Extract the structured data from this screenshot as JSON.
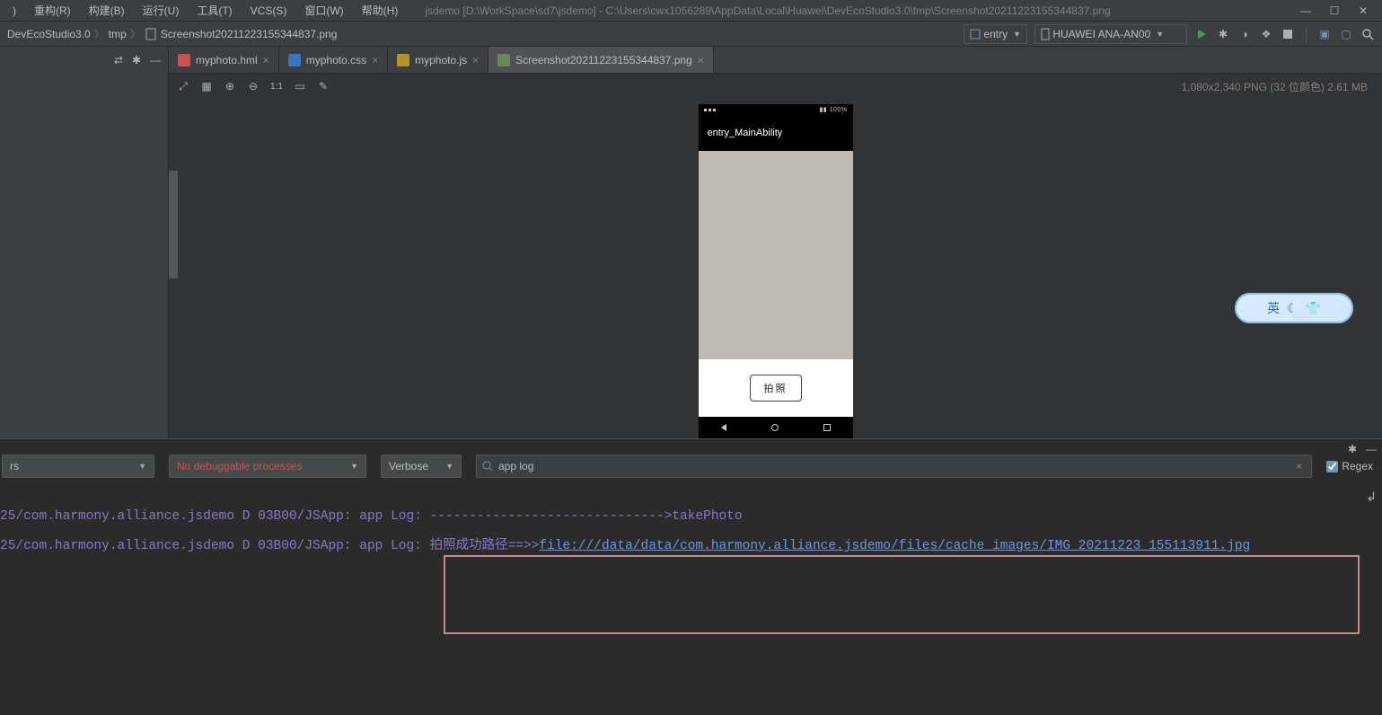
{
  "menu": {
    "items": [
      "重构(R)",
      "构建(B)",
      "运行(U)",
      "工具(T)",
      "VCS(S)",
      "窗口(W)",
      "帮助(H)"
    ]
  },
  "title": "jsdemo [D:\\WorkSpace\\sd7\\jsdemo] - C:\\Users\\cwx1056289\\AppData\\Local\\Huawei\\DevEcoStudio3.0\\tmp\\Screenshot20211223155344837.png",
  "breadcrumb": {
    "items": [
      "DevEcoStudio3.0",
      "tmp",
      "Screenshot20211223155344837.png"
    ]
  },
  "run": {
    "config_label": "entry",
    "device_label": "HUAWEI ANA-AN00"
  },
  "tabs": [
    {
      "label": "myphoto.hml",
      "kind": "hml",
      "active": false
    },
    {
      "label": "myphoto.css",
      "kind": "css",
      "active": false
    },
    {
      "label": "myphoto.js",
      "kind": "js",
      "active": false
    },
    {
      "label": "Screenshot20211223155344837.png",
      "kind": "png",
      "active": true
    }
  ],
  "image_info": "1,080x2,340 PNG (32 位颜色) 2.61 MB",
  "phone": {
    "ability_title": "entry_MainAbility",
    "shutter_label": "拍照"
  },
  "log": {
    "device_selector": "rs",
    "process_selector": "No debuggable processes",
    "level": "Verbose",
    "search_text": "app log",
    "regex_label": "Regex",
    "lines": [
      {
        "prefix": "25/com.harmony.alliance.jsdemo D 03B00/JSApp:  app Log: ",
        "mid": "------------------------------>takePhoto",
        "link": ""
      },
      {
        "prefix": "25/com.harmony.alliance.jsdemo D 03B00/JSApp:  app Log: 拍照成功路径==>>",
        "mid": "",
        "link": "file:///data/data/com.harmony.alliance.jsdemo/files/cache_images/IMG_20211223_155113911.jpg"
      }
    ]
  },
  "ime": {
    "label": "英"
  }
}
